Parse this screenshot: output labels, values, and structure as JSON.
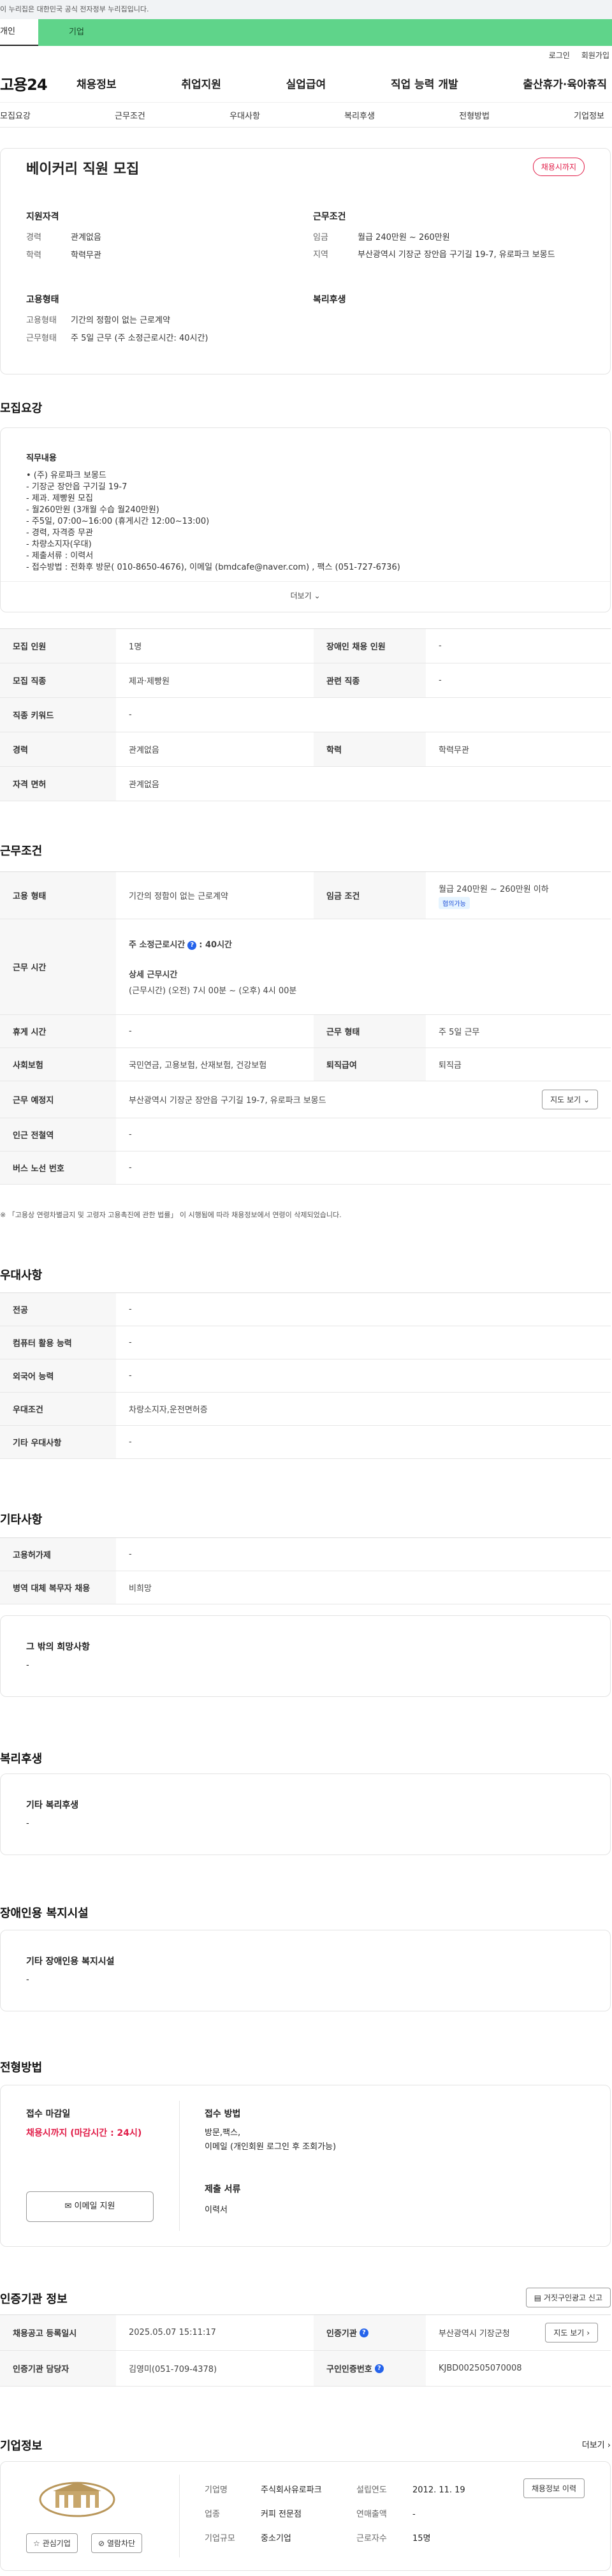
{
  "gov_banner": "이 누리집은 대한민국 공식 전자정부 누리집입니다.",
  "member_tabs": {
    "person": "개인",
    "company": "기업"
  },
  "top_links": {
    "login": "로그인",
    "join": "회원가입"
  },
  "logo": "고용24",
  "gnb": [
    "채용정보",
    "취업지원",
    "실업급여",
    "직업 능력 개발",
    "출산휴가·육아휴직"
  ],
  "subnav": [
    "모집요강",
    "근무조건",
    "우대사항",
    "복리후생",
    "전형방법",
    "기업정보"
  ],
  "header_card": {
    "title": "베이커리 직원 모집",
    "status": "채용시까지",
    "qual_title": "지원자격",
    "qual": [
      {
        "k": "경력",
        "v": "관계없음"
      },
      {
        "k": "학력",
        "v": "학력무관"
      }
    ],
    "cond_title": "근무조건",
    "cond": [
      {
        "k": "임금",
        "v": "월급 240만원 ~ 260만원"
      },
      {
        "k": "지역",
        "v": "부산광역시 기장군 장안읍 구기길 19-7, 유로파크 보몽드"
      }
    ],
    "emp_title": "고용형태",
    "emp": [
      {
        "k": "고용형태",
        "v": "기간의 정함이 없는 근로계약"
      },
      {
        "k": "근무형태",
        "v": "주 5일 근무 (주 소정근로시간: 40시간)"
      }
    ],
    "welfare_title": "복리후생"
  },
  "recruit": {
    "section_title": "모집요강",
    "duty_title": "직무내용",
    "duty_lines": [
      "• (주) 유로파크 보몽드",
      "- 기장군 장안읍 구기길 19-7",
      "- 제과. 제빵원 모집",
      "- 월260만원 (3개월 수습 월240만원)",
      "- 주5일, 07:00~16:00 (휴게시간 12:00~13:00)",
      "- 경력, 자격증 무관",
      "- 차량소지자(우대)",
      "- 제출서류 : 이력서",
      "- 접수방법 : 전화후 방문( 010-8650-4676), 이메일 (bmdcafe@naver.com) , 팩스 (051-727-6736)"
    ],
    "more": "더보기",
    "table": [
      [
        {
          "th": "모집 인원",
          "td": "1명"
        },
        {
          "th": "장애인 채용 인원",
          "td": "-"
        }
      ],
      [
        {
          "th": "모집 직종",
          "td": "제과·제빵원"
        },
        {
          "th": "관련 직종",
          "td": "-"
        }
      ],
      [
        {
          "th": "직종 키워드",
          "td": "-"
        }
      ],
      [
        {
          "th": "경력",
          "td": "관계없음"
        },
        {
          "th": "학력",
          "td": "학력무관"
        }
      ],
      [
        {
          "th": "자격 면허",
          "td": "관계없음"
        }
      ]
    ]
  },
  "conditions": {
    "section_title": "근무조건",
    "emp_type_th": "고용 형태",
    "emp_type_td": "기간의 정함이 없는 근로계약",
    "wage_th": "임금 조건",
    "wage_td": "월급 240만원 ~ 260만원 이하",
    "wage_chip": "협의가능",
    "hours_th": "근무 시간",
    "hours_weekly_label": "주 소정근로시간",
    "hours_weekly_value": ": 40시간",
    "hours_detail_label": "상세 근무시간",
    "hours_detail_value": "(근무시간) (오전) 7시 00분 ~ (오후) 4시 00분",
    "holiday_th": "휴게 시간",
    "holiday_td": "-",
    "worktype_th": "근무 형태",
    "worktype_td": "주 5일 근무",
    "insurance_th": "사회보험",
    "insurance_td": "국민연금, 고용보험, 산재보험, 건강보험",
    "retire_th": "퇴직급여",
    "retire_td": "퇴직금",
    "place_th": "근무 예정지",
    "place_td": "부산광역시 기장군 장안읍 구기길 19-7, 유로파크 보몽드",
    "map_btn": "지도 보기",
    "station_th": "인근 전철역",
    "station_td": "-",
    "bus_th": "버스 노선 번호",
    "bus_td": "-",
    "note": "※ 「고용상 연령차별금지 및 고령자 고용촉진에 관한 법률」 이 시행됨에 따라 채용정보에서 연령이 삭제되었습니다."
  },
  "prefer": {
    "section_title": "우대사항",
    "rows": [
      {
        "th": "전공",
        "td": "-"
      },
      {
        "th": "컴퓨터 활용 능력",
        "td": "-"
      },
      {
        "th": "외국어 능력",
        "td": "-"
      },
      {
        "th": "우대조건",
        "td": "차량소지자,운전면허증"
      },
      {
        "th": "기타 우대사항",
        "td": "-"
      }
    ]
  },
  "etc": {
    "section_title": "기타사항",
    "rows": [
      {
        "th": "고용허가제",
        "td": "-"
      },
      {
        "th": "병역 대체 복무자 채용",
        "td": "비희망"
      }
    ],
    "hope_title": "그 밖의 희망사항",
    "hope_value": "-"
  },
  "welfare": {
    "section_title": "복리후생",
    "box_title": "기타 복리후생",
    "box_value": "-"
  },
  "disability": {
    "section_title": "장애인용 복지시설",
    "box_title": "기타 장애인용 복지시설",
    "box_value": "-"
  },
  "selection": {
    "section_title": "전형방법",
    "deadline_title": "접수 마감일",
    "deadline_value": "채용시까지 (마감시간 : 24시)",
    "email_btn": "이메일 지원",
    "method_title": "접수 방법",
    "method_lines": [
      "방문,팩스,",
      "이메일 (개인회원 로그인 후 조회가능)"
    ],
    "docs_title": "제출 서류",
    "docs_value": "이력서"
  },
  "cert": {
    "section_title": "인증기관 정보",
    "report_btn": "거짓구인광고 신고",
    "reg_th": "채용공고 등록일시",
    "reg_td": "2025.05.07 15:11:17",
    "org_th": "인증기관",
    "org_td": "부산광역시 기장군청",
    "map_btn": "지도 보기",
    "mgr_th": "인증기관 담당자",
    "mgr_td": "김영미(051-709-4378)",
    "num_th": "구인인증번호",
    "num_td": "KJBD002505070008"
  },
  "company": {
    "section_title": "기업정보",
    "more": "더보기",
    "fav_btn": "관심기업",
    "block_btn": "열람차단",
    "history_btn": "채용정보 이력",
    "rows": [
      [
        {
          "k": "기업명",
          "v": "주식회사유로파크"
        },
        {
          "k": "설립연도",
          "v": "2012. 11. 19"
        }
      ],
      [
        {
          "k": "업종",
          "v": "커피 전문점"
        },
        {
          "k": "연매출액",
          "v": "-"
        }
      ],
      [
        {
          "k": "기업규모",
          "v": "중소기업"
        },
        {
          "k": "근로자수",
          "v": "15명"
        }
      ]
    ]
  }
}
